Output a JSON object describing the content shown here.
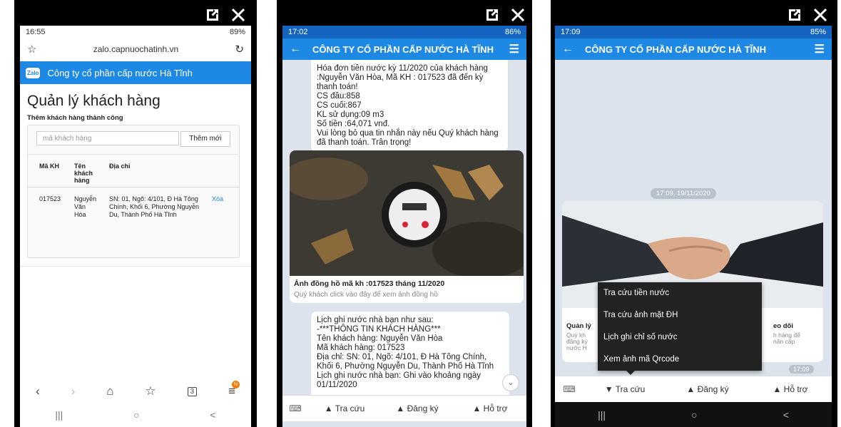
{
  "screen1": {
    "status_time": "16:55",
    "status_right": "89%",
    "url": "zalo.capnuochatinh.vn",
    "zalo_badge": "Zalo",
    "site_title": "Công ty cổ phần cấp nước Hà Tĩnh",
    "page_title": "Quản lý khách hàng",
    "success_msg": "Thêm khách hàng thành công",
    "input_placeholder": "mã khách hàng",
    "add_button": "Thêm mới",
    "headers": [
      "Mã KH",
      "Tên khách hàng",
      "Địa chỉ"
    ],
    "row": {
      "id": "017523",
      "name": "Nguyễn Văn Hòa",
      "address": "SN: 01, Ngõ: 4/101, Đ Hà Tông Chính, Khối 6, Phường Nguyễn Du, Thành Phố Hà Tĩnh",
      "delete": "Xóa"
    },
    "tabs_count": "3",
    "notif_badge": "N"
  },
  "screen2": {
    "status_time": "17:02",
    "status_right": "86%",
    "title": "CÔNG TY CỔ PHẦN CẤP NƯỚC HÀ TĨNH",
    "msg1": "Hóa đơn tiền nước  kỳ 11/2020 của khách hàng :Nguyễn Văn Hòa, Mã KH : 017523 đã đến kỳ thanh toán!\nCS đầu:858\nCS cuối:867\nKL sử dụng:09 m3\nSố tiền :64,071 vnđ.\nVui lòng bỏ qua tin nhắn này nếu Quý khách hàng đã thanh toán. Trân trọng!",
    "photo_caption": "Ảnh đồng hồ mã kh :017523 tháng 11/2020",
    "photo_sub": "Quý khách click vào đây để xem ảnh đồng hồ",
    "msg2": "Lịch ghi nước nhà bạn như sau:\n-***THÔNG TIN KHÁCH HÀNG***\nTên khách hàng: Nguyễn Văn Hòa\nMã khách hàng: 017523\nĐịa chỉ: SN: 01, Ngõ: 4/101, Đ Hà Tông Chính, Khối 6, Phường Nguyễn Du, Thành Phố Hà Tĩnh\nLịch ghi nước nhà bạn: Ghi vào khoảng ngày 01/11/2020",
    "menu": [
      "▲ Tra cứu",
      "▲ Đăng ký",
      "▲ Hỗ trợ"
    ]
  },
  "screen3": {
    "status_time": "17:09",
    "status_right": "85%",
    "title": "CÔNG TY CỔ PHẦN CẤP NƯỚC HÀ TĨNH",
    "timestamp": "17:09, 19/11/2020",
    "card_left_title": "Quản lý",
    "card_left_text": "Quý kh\nđăng ký\nnước H",
    "card_right_title": "eo dõi",
    "card_right_text": "h hàng để\nnăn cấp",
    "time_badge": "17:09",
    "popup": [
      "Tra cứu tiền nước",
      "Tra cứu ảnh mặt ĐH",
      "Lịch ghi chỉ số nước",
      "Xem ảnh mã Qrcode"
    ],
    "menu": [
      "▼ Tra cứu",
      "▲ Đăng ký",
      "▲ Hỗ trợ"
    ]
  },
  "nav": {
    "recent": "|||",
    "home": "○",
    "back": "<"
  },
  "colors": {
    "zalo_blue": "#1e88e5",
    "chat_bg": "#dde3ec",
    "popup_bg": "#222222"
  }
}
